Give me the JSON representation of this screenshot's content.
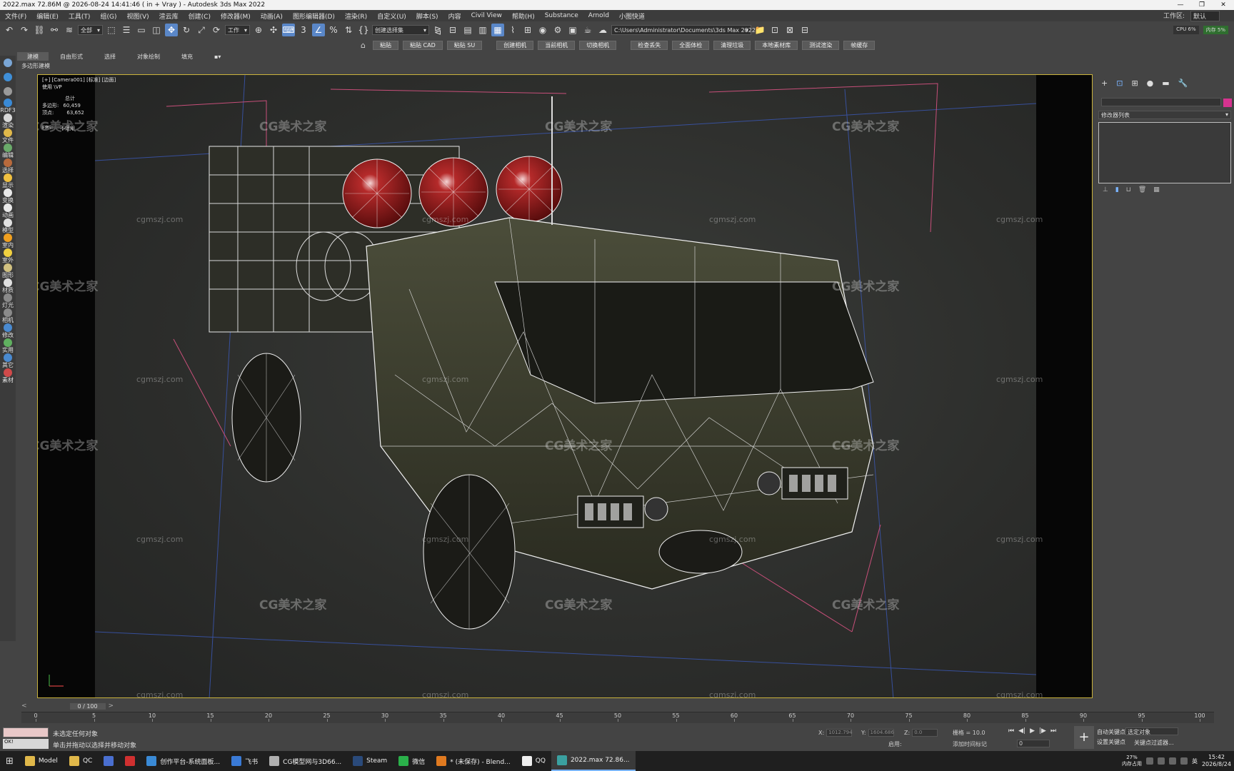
{
  "titlebar": {
    "title": "2022.max  72.86M @ 2026-08-24 14:41:46  ( in + Vray ) - Autodesk 3ds Max 2022",
    "minimize": "—",
    "restore": "❐",
    "close": "✕"
  },
  "menu": {
    "items": [
      "文件(F)",
      "编辑(E)",
      "工具(T)",
      "组(G)",
      "视图(V)",
      "渲云库",
      "创建(C)",
      "修改器(M)",
      "动画(A)",
      "图形编辑器(D)",
      "渲染(R)",
      "自定义(U)",
      "脚本(S)",
      "内容",
      "Civil View",
      "帮助(H)",
      "Substance",
      "Arnold",
      "小图快道"
    ],
    "workspace_label": "工作区:",
    "workspace_value": "默认"
  },
  "toolbar": {
    "selection_filter": "全部",
    "ref_coord": "工作",
    "named_selection": "创建选择集",
    "project_path": "C:\\Users\\Administrator\\Documents\\3ds Max 2022",
    "cpu": "CPU 6%",
    "mem": "内存 5%"
  },
  "plugins": {
    "buttons": [
      "粘贴",
      "粘贴 CAD",
      "粘贴 SU",
      "创建相机",
      "当前相机",
      "切换相机",
      "检查丢失",
      "全面体检",
      "清理垃圾",
      "本地素材库",
      "测试渲染",
      "帧缓存"
    ]
  },
  "ribbon": {
    "tabs": [
      "建模",
      "自由形式",
      "选择",
      "对象绘制",
      "填充"
    ],
    "active_tab": "建模",
    "sub_label": "多边形建模"
  },
  "left_panel": {
    "items": [
      {
        "label": "",
        "icon": "teapot-icon",
        "color": "#7aa6d6"
      },
      {
        "label": "",
        "icon": "sphere-icon",
        "color": "#3f8fd8"
      },
      {
        "label": "",
        "icon": "box-icon",
        "color": "#9a9a9a"
      },
      {
        "label": "RDF3",
        "icon": "rdf-icon",
        "color": "#3a8ad6"
      },
      {
        "label": "渲染",
        "icon": "render-icon",
        "color": "#d8d8d8"
      },
      {
        "label": "文件",
        "icon": "file-icon",
        "color": "#e0b84a"
      },
      {
        "label": "编辑",
        "icon": "edit-icon",
        "color": "#6aaa6a"
      },
      {
        "label": "选择",
        "icon": "select-icon",
        "color": "#b86a3c"
      },
      {
        "label": "显示",
        "icon": "display-icon",
        "color": "#f0c040"
      },
      {
        "label": "变换",
        "icon": "transform-icon",
        "color": "#e8e8e8"
      },
      {
        "label": "动画",
        "icon": "animation-icon",
        "color": "#e8e8e8"
      },
      {
        "label": "模型",
        "icon": "model-icon",
        "color": "#e0e0e0"
      },
      {
        "label": "室内",
        "icon": "interior-icon",
        "color": "#f0a020"
      },
      {
        "label": "室外",
        "icon": "exterior-icon",
        "color": "#f0d040"
      },
      {
        "label": "图形",
        "icon": "shape-icon",
        "color": "#d0c080"
      },
      {
        "label": "材质",
        "icon": "material-icon",
        "color": "#e0e0e0"
      },
      {
        "label": "灯光",
        "icon": "light-icon",
        "color": "#8a8a8a"
      },
      {
        "label": "相机",
        "icon": "camera-icon",
        "color": "#8a8a8a"
      },
      {
        "label": "修改",
        "icon": "modify-icon",
        "color": "#4a8ad0"
      },
      {
        "label": "实用",
        "icon": "utility-icon",
        "color": "#60b060"
      },
      {
        "label": "其它",
        "icon": "other-icon",
        "color": "#4a8ad0"
      },
      {
        "label": "素材",
        "icon": "assets-icon",
        "color": "#d04a4a"
      }
    ]
  },
  "viewport": {
    "label": "[+] [Camera001] [标准] [边面]",
    "sublabel": "使用 \\VP",
    "stats_title": "总计",
    "polys_label": "多边形:",
    "polys_value": "60,459",
    "verts_label": "顶点:",
    "verts_value": "63,652",
    "fps_label": "FPS:",
    "fps_value": "不适用",
    "watermark": "CG美术之家",
    "watermark_url": "cgmszj.com"
  },
  "right_panel": {
    "tabs": [
      "+",
      "⊡",
      "⊞",
      "●",
      "▬",
      "🔧"
    ],
    "modifier_list": "修改器列表",
    "object_color": "#d6338f"
  },
  "timeline": {
    "frame_display": "0 / 100",
    "ticks": [
      0,
      5,
      10,
      15,
      20,
      25,
      30,
      35,
      40,
      45,
      50,
      55,
      60,
      65,
      70,
      75,
      80,
      85,
      90,
      95,
      100
    ]
  },
  "status": {
    "miniscript": "OK!",
    "msg_selected": "未选定任何对象",
    "msg_prompt": "单击并拖动以选择并移动对象",
    "x_label": "X:",
    "x_value": "1012.794",
    "y_label": "Y:",
    "y_value": "1604.686",
    "z_label": "Z:",
    "z_value": "0.0",
    "grid": "栅格 = 10.0",
    "add_time_tag": "添加时间标记",
    "enabled_label": "启用:",
    "frame_value": "0",
    "auto_key": "自动关键点",
    "set_key": "设置关键点",
    "key_mode": "选定对象",
    "key_filters": "关键点过滤器..."
  },
  "taskbar": {
    "items": [
      {
        "label": "Model",
        "color": "#e0b84a"
      },
      {
        "label": "QC",
        "color": "#e0b84a"
      },
      {
        "label": "",
        "color": "#4a6fd0"
      },
      {
        "label": "",
        "color": "#d03030"
      },
      {
        "label": "创作平台-系统面板...",
        "color": "#3a8ad6"
      },
      {
        "label": "飞书",
        "color": "#3a7ad6"
      },
      {
        "label": "CG模型网与3D66...",
        "color": "#b0b0b0"
      },
      {
        "label": "Steam",
        "color": "#2a4a7a"
      },
      {
        "label": "微信",
        "color": "#2ab04a"
      },
      {
        "label": "* (未保存) - Blend...",
        "color": "#e07a20"
      },
      {
        "label": "QQ",
        "color": "#eeeeee"
      },
      {
        "label": "2022.max  72.86...",
        "color": "#3aa0a0"
      }
    ],
    "perf_value": "27%",
    "perf_label": "内存占用",
    "ime": "英",
    "time": "15:42",
    "date": "2026/8/24"
  }
}
